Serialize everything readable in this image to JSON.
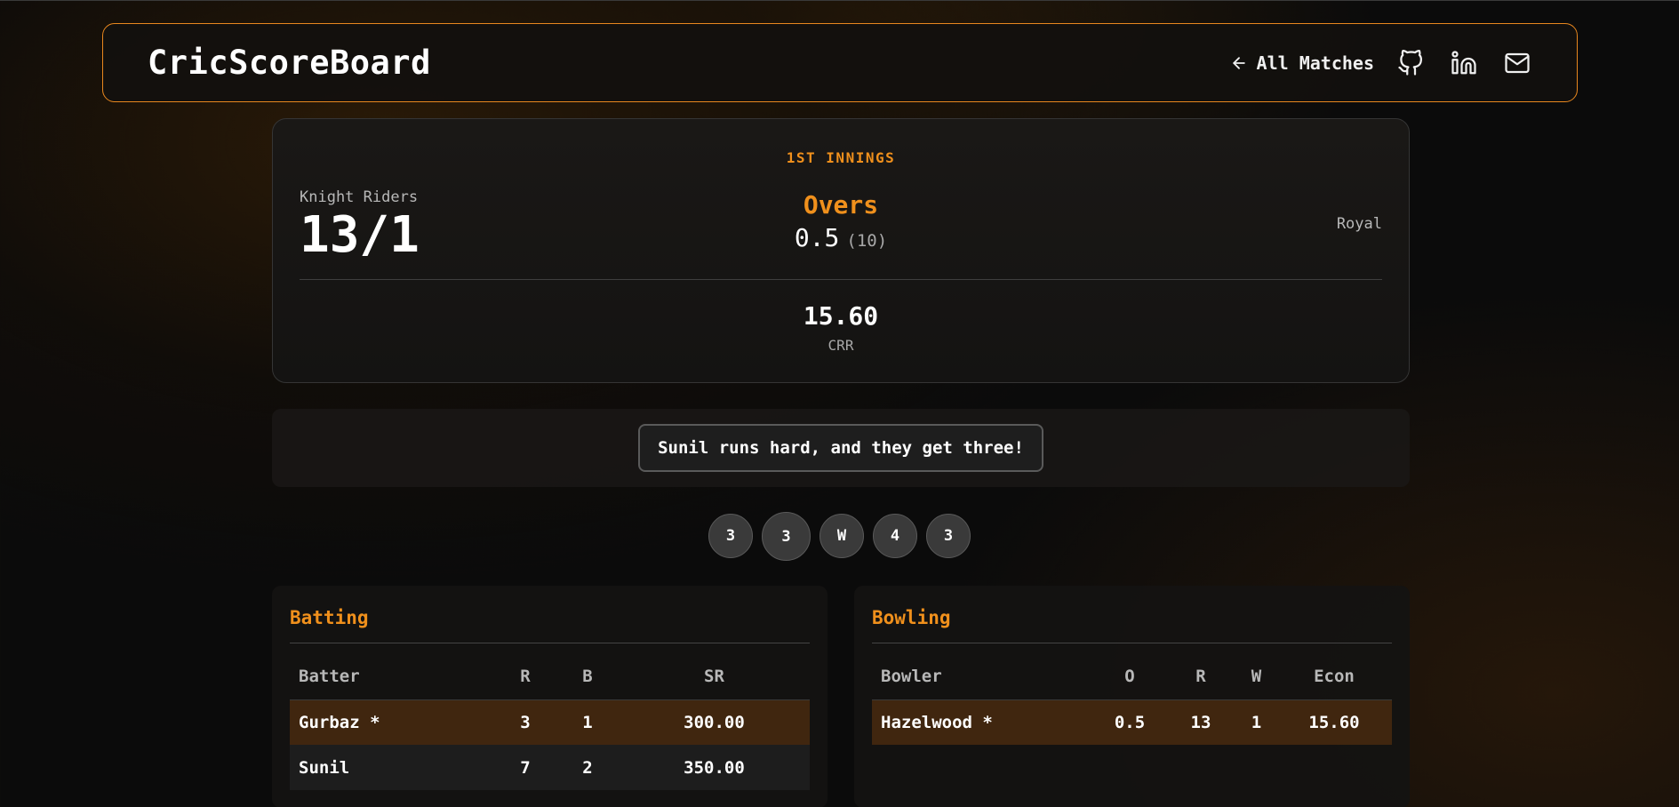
{
  "header": {
    "brand": "CricScoreBoard",
    "back_label": "All Matches",
    "icons": [
      "arrow-left-icon",
      "github-icon",
      "linkedin-icon",
      "mail-icon"
    ],
    "accent_color": "#e8871e"
  },
  "score": {
    "innings": "1ST INNINGS",
    "batting_team": "Knight Riders",
    "runs_wickets": "13/1",
    "overs_label": "Overs",
    "overs": "0.5",
    "balls": "(10)",
    "bowling_team": "Royal",
    "crr": "15.60",
    "crr_label": "CRR"
  },
  "commentary": "Sunil runs hard, and they get three!",
  "recent_balls": [
    "3",
    "3",
    "W",
    "4",
    "3"
  ],
  "batting": {
    "title": "Batting",
    "headers": [
      "Batter",
      "R",
      "B",
      "SR"
    ],
    "rows": [
      [
        "Gurbaz *",
        "3",
        "1",
        "300.00"
      ],
      [
        "Sunil",
        "7",
        "2",
        "350.00"
      ]
    ]
  },
  "bowling": {
    "title": "Bowling",
    "headers": [
      "Bowler",
      "O",
      "R",
      "W",
      "Econ"
    ],
    "rows": [
      [
        "Hazelwood *",
        "0.5",
        "13",
        "1",
        "15.60"
      ]
    ]
  }
}
